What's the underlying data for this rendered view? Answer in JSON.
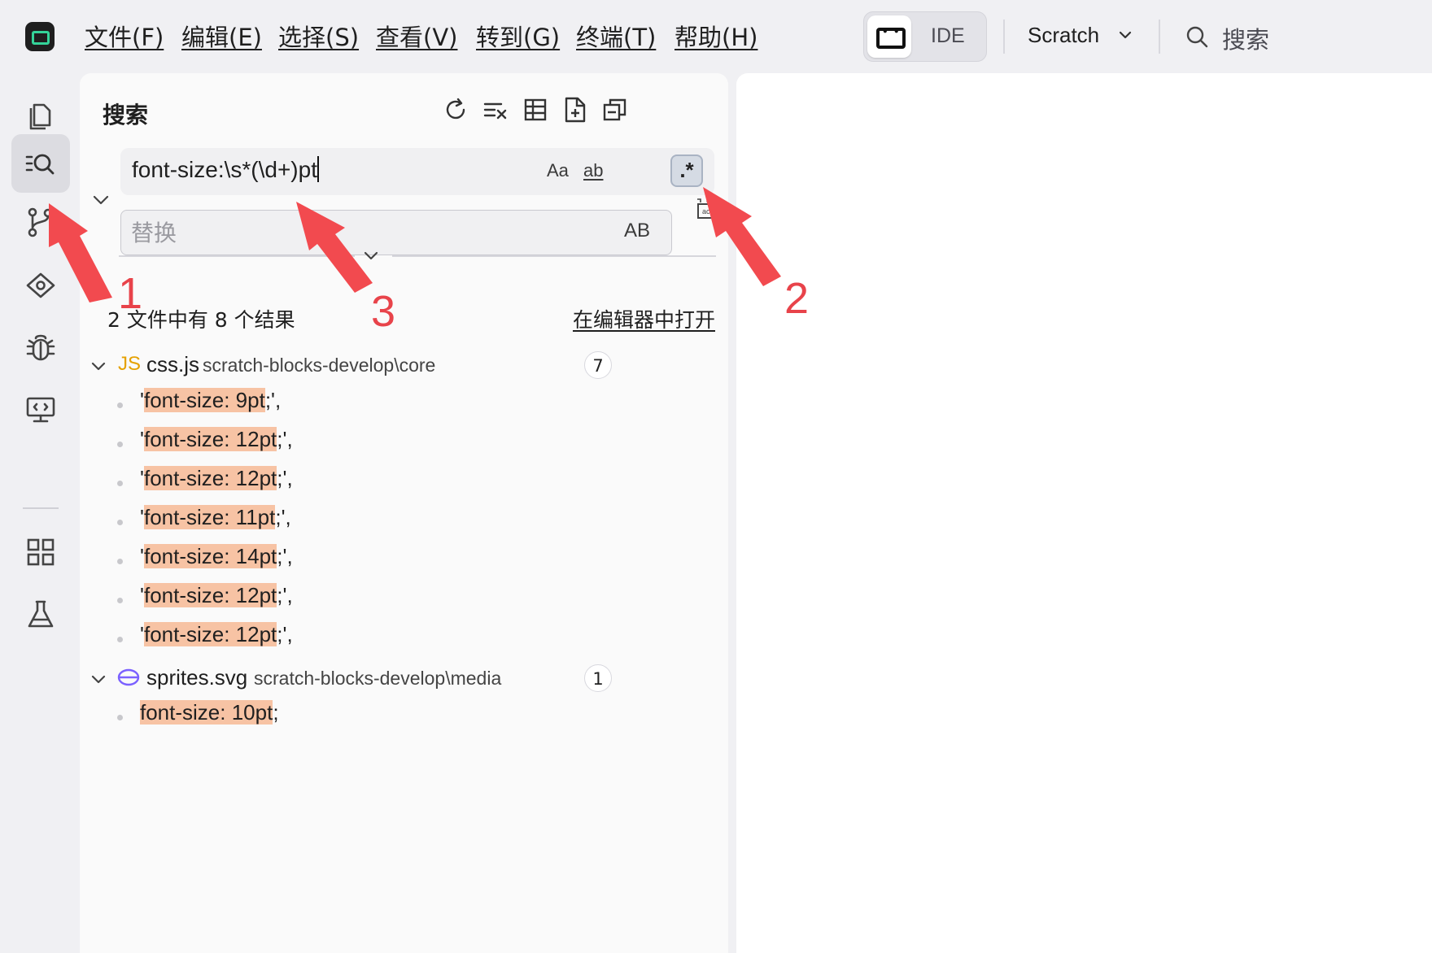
{
  "menubar": {
    "items": [
      "文件(F)",
      "编辑(E)",
      "选择(S)",
      "查看(V)",
      "转到(G)",
      "终端(T)",
      "帮助(H)"
    ],
    "ide_label": "IDE",
    "project_name": "Scratch",
    "search_label": "搜索"
  },
  "search_panel": {
    "title": "搜索",
    "query": "font-size:\\s*(\\d+)pt",
    "options": {
      "match_case": "Aa",
      "whole_word": "ab",
      "regex": ".*"
    },
    "replace_placeholder": "替换",
    "preserve_case": "AB",
    "summary": "2 文件中有 8 个结果",
    "open_in_editor": "在编辑器中打开",
    "files": [
      {
        "icon": "JS",
        "name": "css.js",
        "path": "scratch-blocks-develop\\core",
        "count": "7",
        "matches": [
          {
            "pre": "'",
            "hl": "font-size: 9pt",
            "post": ";',"
          },
          {
            "pre": "'",
            "hl": "font-size: 12pt",
            "post": ";',"
          },
          {
            "pre": "'",
            "hl": "font-size: 12pt",
            "post": ";',"
          },
          {
            "pre": "'",
            "hl": "font-size: 11pt",
            "post": ";',"
          },
          {
            "pre": "'",
            "hl": "font-size: 14pt",
            "post": ";',"
          },
          {
            "pre": "'",
            "hl": "font-size: 12pt",
            "post": ";',"
          },
          {
            "pre": "'",
            "hl": "font-size: 12pt",
            "post": ";',"
          }
        ]
      },
      {
        "icon": "svg-icon",
        "name": "sprites.svg",
        "path": "scratch-blocks-develop\\media",
        "count": "1",
        "matches": [
          {
            "pre": "",
            "hl": "font-size: 10pt",
            "post": ";"
          }
        ]
      }
    ]
  },
  "annotations": {
    "one": "1",
    "two": "2",
    "three": "3"
  },
  "colors": {
    "annotation_red": "#e8434a",
    "match_highlight": "#f7c3a4",
    "js_icon": "#e5a100",
    "svg_icon": "#7b61ff"
  }
}
